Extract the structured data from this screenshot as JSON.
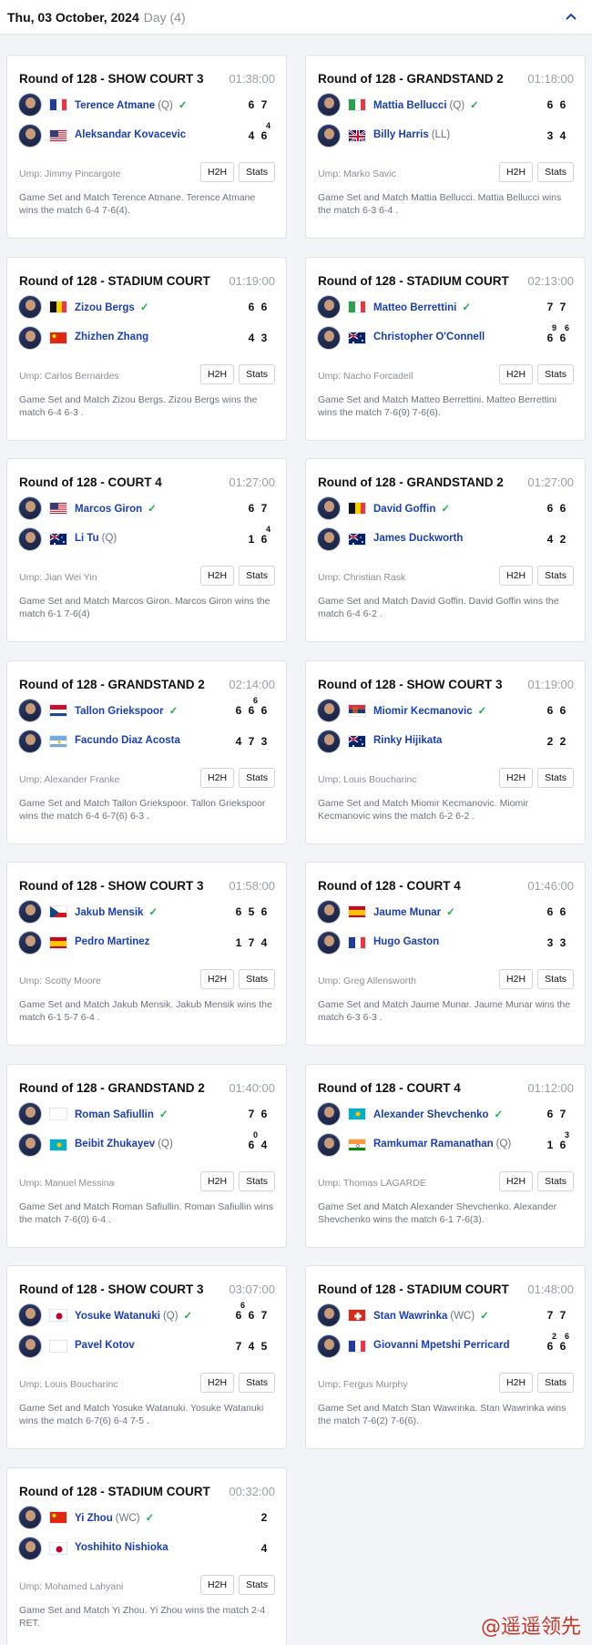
{
  "header": {
    "date": "Thu, 03 October, 2024",
    "day": "Day (4)"
  },
  "buttons": {
    "h2h": "H2H",
    "stats": "Stats"
  },
  "matches": [
    {
      "title": "Round of 128 - SHOW COURT 3",
      "duration": "01:38:00",
      "p1": {
        "name": "Terence Atmane",
        "tag": "(Q)",
        "winner": true,
        "flag": "france",
        "scores": [
          "6",
          "7"
        ],
        "tb": [
          "",
          ""
        ]
      },
      "p2": {
        "name": "Aleksandar Kovacevic",
        "tag": "",
        "winner": false,
        "flag": "usa",
        "scores": [
          "4",
          "6"
        ],
        "tb": [
          "",
          "4"
        ]
      },
      "umpire": "Ump: Jimmy Pincargote",
      "summary": "Game Set and Match Terence Atmane. Terence Atmane wins the match 6-4 7-6(4)."
    },
    {
      "title": "Round of 128 - GRANDSTAND 2",
      "duration": "01:18:00",
      "p1": {
        "name": "Mattia Bellucci",
        "tag": "(Q)",
        "winner": true,
        "flag": "italy",
        "scores": [
          "6",
          "6"
        ],
        "tb": [
          "",
          ""
        ]
      },
      "p2": {
        "name": "Billy Harris",
        "tag": "(LL)",
        "winner": false,
        "flag": "uk",
        "scores": [
          "3",
          "4"
        ],
        "tb": [
          "",
          ""
        ]
      },
      "umpire": "Ump: Marko Savic",
      "summary": "Game Set and Match Mattia Bellucci. Mattia Bellucci wins the match 6-3 6-4 ."
    },
    {
      "title": "Round of 128 - STADIUM COURT",
      "duration": "01:19:00",
      "p1": {
        "name": "Zizou Bergs",
        "tag": "",
        "winner": true,
        "flag": "belgium",
        "scores": [
          "6",
          "6"
        ],
        "tb": [
          "",
          ""
        ]
      },
      "p2": {
        "name": "Zhizhen Zhang",
        "tag": "",
        "winner": false,
        "flag": "china",
        "scores": [
          "4",
          "3"
        ],
        "tb": [
          "",
          ""
        ]
      },
      "umpire": "Ump: Carlos Bernardes",
      "summary": "Game Set and Match Zizou Bergs. Zizou Bergs wins the match 6-4 6-3 ."
    },
    {
      "title": "Round of 128 - STADIUM COURT",
      "duration": "02:13:00",
      "p1": {
        "name": "Matteo Berrettini",
        "tag": "",
        "winner": true,
        "flag": "italy",
        "scores": [
          "7",
          "7"
        ],
        "tb": [
          "",
          ""
        ]
      },
      "p2": {
        "name": "Christopher O'Connell",
        "tag": "",
        "winner": false,
        "flag": "australia",
        "scores": [
          "6",
          "6"
        ],
        "tb": [
          "9",
          "6"
        ]
      },
      "umpire": "Ump: Nacho Forcadell",
      "summary": "Game Set and Match Matteo Berrettini. Matteo Berrettini wins the match 7-6(9) 7-6(6)."
    },
    {
      "title": "Round of 128 - COURT 4",
      "duration": "01:27:00",
      "p1": {
        "name": "Marcos Giron",
        "tag": "",
        "winner": true,
        "flag": "usa",
        "scores": [
          "6",
          "7"
        ],
        "tb": [
          "",
          ""
        ]
      },
      "p2": {
        "name": "Li Tu",
        "tag": "(Q)",
        "winner": false,
        "flag": "australia",
        "scores": [
          "1",
          "6"
        ],
        "tb": [
          "",
          "4"
        ]
      },
      "umpire": "Ump: Jian Wei Yin",
      "summary": "Game Set and Match Marcos Giron. Marcos Giron wins the match 6-1 7-6(4)"
    },
    {
      "title": "Round of 128 - GRANDSTAND 2",
      "duration": "01:27:00",
      "p1": {
        "name": "David Goffin",
        "tag": "",
        "winner": true,
        "flag": "belgium",
        "scores": [
          "6",
          "6"
        ],
        "tb": [
          "",
          ""
        ]
      },
      "p2": {
        "name": "James Duckworth",
        "tag": "",
        "winner": false,
        "flag": "australia",
        "scores": [
          "4",
          "2"
        ],
        "tb": [
          "",
          ""
        ]
      },
      "umpire": "Ump: Christian Rask",
      "summary": "Game Set and Match David Goffin. David Goffin wins the match 6-4 6-2 ."
    },
    {
      "title": "Round of 128 - GRANDSTAND 2",
      "duration": "02:14:00",
      "p1": {
        "name": "Tallon Griekspoor",
        "tag": "",
        "winner": true,
        "flag": "netherlands",
        "scores": [
          "6",
          "6",
          "6"
        ],
        "tb": [
          "",
          "6",
          ""
        ]
      },
      "p2": {
        "name": "Facundo Diaz Acosta",
        "tag": "",
        "winner": false,
        "flag": "argentina",
        "scores": [
          "4",
          "7",
          "3"
        ],
        "tb": [
          "",
          "",
          ""
        ]
      },
      "umpire": "Ump: Alexander Franke",
      "summary": "Game Set and Match Tallon Griekspoor. Tallon Griekspoor wins the match 6-4 6-7(6) 6-3 ."
    },
    {
      "title": "Round of 128 - SHOW COURT 3",
      "duration": "01:19:00",
      "p1": {
        "name": "Miomir Kecmanovic",
        "tag": "",
        "winner": true,
        "flag": "serbia",
        "scores": [
          "6",
          "6"
        ],
        "tb": [
          "",
          ""
        ]
      },
      "p2": {
        "name": "Rinky Hijikata",
        "tag": "",
        "winner": false,
        "flag": "australia",
        "scores": [
          "2",
          "2"
        ],
        "tb": [
          "",
          ""
        ]
      },
      "umpire": "Ump: Louis Boucharinc",
      "summary": "Game Set and Match Miomir Kecmanovic. Miomir Kecmanovic wins the match 6-2 6-2 ."
    },
    {
      "title": "Round of 128 - SHOW COURT 3",
      "duration": "01:58:00",
      "p1": {
        "name": "Jakub Mensik",
        "tag": "",
        "winner": true,
        "flag": "czech",
        "scores": [
          "6",
          "5",
          "6"
        ],
        "tb": [
          "",
          "",
          ""
        ]
      },
      "p2": {
        "name": "Pedro Martinez",
        "tag": "",
        "winner": false,
        "flag": "spain",
        "scores": [
          "1",
          "7",
          "4"
        ],
        "tb": [
          "",
          "",
          ""
        ]
      },
      "umpire": "Ump: Scotty Moore",
      "summary": "Game Set and Match Jakub Mensik. Jakub Mensik wins the match 6-1 5-7 6-4 ."
    },
    {
      "title": "Round of 128 - COURT 4",
      "duration": "01:46:00",
      "p1": {
        "name": "Jaume Munar",
        "tag": "",
        "winner": true,
        "flag": "spain",
        "scores": [
          "6",
          "6"
        ],
        "tb": [
          "",
          ""
        ]
      },
      "p2": {
        "name": "Hugo Gaston",
        "tag": "",
        "winner": false,
        "flag": "france",
        "scores": [
          "3",
          "3"
        ],
        "tb": [
          "",
          ""
        ]
      },
      "umpire": "Ump: Greg Allensworth",
      "summary": "Game Set and Match Jaume Munar. Jaume Munar wins the match 6-3 6-3 ."
    },
    {
      "title": "Round of 128 - GRANDSTAND 2",
      "duration": "01:40:00",
      "p1": {
        "name": "Roman Safiullin",
        "tag": "",
        "winner": true,
        "flag": "blank",
        "scores": [
          "7",
          "6"
        ],
        "tb": [
          "",
          ""
        ]
      },
      "p2": {
        "name": "Beibit Zhukayev",
        "tag": "(Q)",
        "winner": false,
        "flag": "kazakhstan",
        "scores": [
          "6",
          "4"
        ],
        "tb": [
          "0",
          ""
        ]
      },
      "umpire": "Ump: Manuel Messina",
      "summary": "Game Set and Match Roman Safiullin. Roman Safiullin wins the match 7-6(0) 6-4 ."
    },
    {
      "title": "Round of 128 - COURT 4",
      "duration": "01:12:00",
      "p1": {
        "name": "Alexander Shevchenko",
        "tag": "",
        "winner": true,
        "flag": "kazakhstan",
        "scores": [
          "6",
          "7"
        ],
        "tb": [
          "",
          ""
        ]
      },
      "p2": {
        "name": "Ramkumar Ramanathan",
        "tag": "(Q)",
        "winner": false,
        "flag": "india",
        "scores": [
          "1",
          "6"
        ],
        "tb": [
          "",
          "3"
        ]
      },
      "umpire": "Ump: Thomas LAGARDE",
      "summary": "Game Set and Match Alexander Shevchenko. Alexander Shevchenko wins the match 6-1 7-6(3)."
    },
    {
      "title": "Round of 128 - SHOW COURT 3",
      "duration": "03:07:00",
      "p1": {
        "name": "Yosuke Watanuki",
        "tag": "(Q)",
        "winner": true,
        "flag": "japan",
        "scores": [
          "6",
          "6",
          "7"
        ],
        "tb": [
          "6",
          "",
          ""
        ]
      },
      "p2": {
        "name": "Pavel Kotov",
        "tag": "",
        "winner": false,
        "flag": "blank",
        "scores": [
          "7",
          "4",
          "5"
        ],
        "tb": [
          "",
          "",
          ""
        ]
      },
      "umpire": "Ump: Louis Boucharinc",
      "summary": "Game Set and Match Yosuke Watanuki. Yosuke Watanuki wins the match 6-7(6) 6-4 7-5 ."
    },
    {
      "title": "Round of 128 - STADIUM COURT",
      "duration": "01:48:00",
      "p1": {
        "name": "Stan Wawrinka",
        "tag": "(WC)",
        "winner": true,
        "flag": "switzerland",
        "scores": [
          "7",
          "7"
        ],
        "tb": [
          "",
          ""
        ]
      },
      "p2": {
        "name": "Giovanni Mpetshi Perricard",
        "tag": "",
        "winner": false,
        "flag": "france",
        "scores": [
          "6",
          "6"
        ],
        "tb": [
          "2",
          "6"
        ]
      },
      "umpire": "Ump: Fergus Murphy",
      "summary": "Game Set and Match Stan Wawrinka. Stan Wawrinka wins the match 7-6(2) 7-6(6)."
    },
    {
      "title": "Round of 128 - STADIUM COURT",
      "duration": "00:32:00",
      "p1": {
        "name": "Yi Zhou",
        "tag": "(WC)",
        "winner": true,
        "flag": "china",
        "scores": [
          "2"
        ],
        "tb": [
          ""
        ]
      },
      "p2": {
        "name": "Yoshihito Nishioka",
        "tag": "",
        "winner": false,
        "flag": "japan",
        "scores": [
          "4"
        ],
        "tb": [
          ""
        ]
      },
      "umpire": "Ump: Mohamed Lahyani",
      "summary": "Game Set and Match Yi Zhou. Yi Zhou wins the match 2-4 RET."
    }
  ],
  "watermark": "@遥遥领先",
  "colors": {
    "player_link": "#1b3fb0",
    "winner_check": "#22b04a",
    "muted": "#8a8f99"
  }
}
